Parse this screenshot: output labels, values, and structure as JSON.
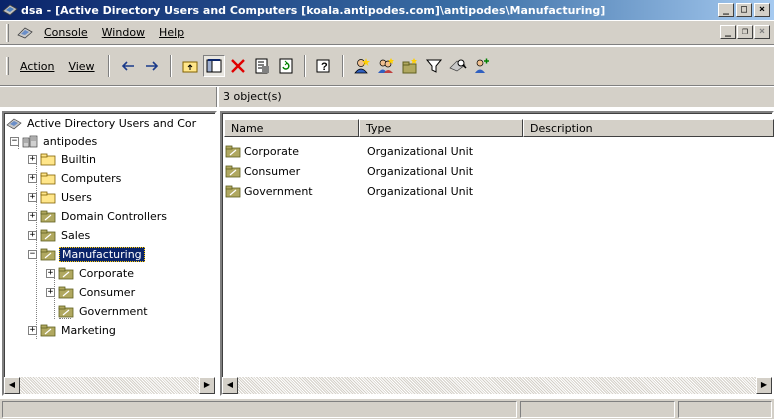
{
  "window": {
    "title": "dsa - [Active Directory Users and Computers [koala.antipodes.com]\\antipodes\\Manufacturing]",
    "minimize": "_",
    "maximize": "□",
    "close": "×"
  },
  "menubar": {
    "console": "Console",
    "window": "Window",
    "help": "Help",
    "mdi_minimize": "_",
    "mdi_restore": "❐",
    "mdi_close": "×"
  },
  "toolbar": {
    "action": "Action",
    "view": "View",
    "icons": [
      "back-arrow",
      "forward-arrow",
      "up-folder",
      "show-hide-tree",
      "delete",
      "properties",
      "refresh",
      "help",
      "new-user",
      "new-group",
      "new-ou",
      "filter",
      "find",
      "add-to-group"
    ]
  },
  "list_header_count": "3 object(s)",
  "tree": {
    "root": "Active Directory Users and Cor",
    "domain": "antipodes",
    "items": [
      {
        "label": "Builtin",
        "type": "folder"
      },
      {
        "label": "Computers",
        "type": "folder"
      },
      {
        "label": "Users",
        "type": "folder"
      },
      {
        "label": "Domain Controllers",
        "type": "ou"
      },
      {
        "label": "Sales",
        "type": "ou"
      },
      {
        "label": "Manufacturing",
        "type": "ou",
        "selected": true
      },
      {
        "label": "Corporate",
        "type": "ou"
      },
      {
        "label": "Consumer",
        "type": "ou"
      },
      {
        "label": "Government",
        "type": "ou"
      },
      {
        "label": "Marketing",
        "type": "ou"
      }
    ]
  },
  "list": {
    "columns": [
      "Name",
      "Type",
      "Description"
    ],
    "rows": [
      {
        "name": "Corporate",
        "type": "Organizational Unit",
        "description": ""
      },
      {
        "name": "Consumer",
        "type": "Organizational Unit",
        "description": ""
      },
      {
        "name": "Government",
        "type": "Organizational Unit",
        "description": ""
      }
    ]
  },
  "colors": {
    "title_start": "#0a246a",
    "title_end": "#a6caf0",
    "chrome": "#d4d0c8",
    "selection": "#0a246a",
    "folder": "#ffe68a",
    "ou": "#b0a860"
  }
}
